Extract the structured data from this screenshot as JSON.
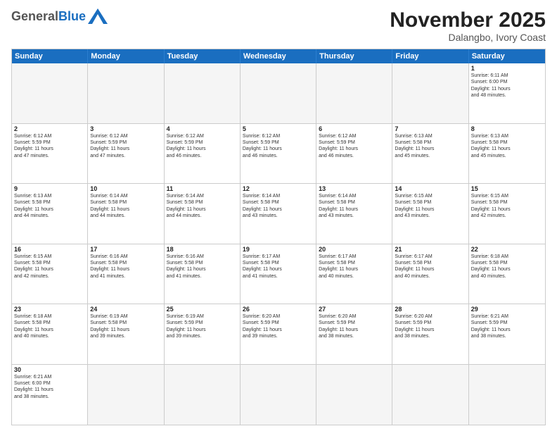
{
  "header": {
    "logo_general": "General",
    "logo_blue": "Blue",
    "month_title": "November 2025",
    "location": "Dalangbo, Ivory Coast"
  },
  "calendar": {
    "days": [
      "Sunday",
      "Monday",
      "Tuesday",
      "Wednesday",
      "Thursday",
      "Friday",
      "Saturday"
    ],
    "cells": [
      {
        "day": "",
        "empty": true,
        "text": ""
      },
      {
        "day": "",
        "empty": true,
        "text": ""
      },
      {
        "day": "",
        "empty": true,
        "text": ""
      },
      {
        "day": "",
        "empty": true,
        "text": ""
      },
      {
        "day": "",
        "empty": true,
        "text": ""
      },
      {
        "day": "",
        "empty": true,
        "text": ""
      },
      {
        "day": "1",
        "empty": false,
        "text": "Sunrise: 6:11 AM\nSunset: 6:00 PM\nDaylight: 11 hours\nand 48 minutes."
      },
      {
        "day": "2",
        "empty": false,
        "text": "Sunrise: 6:12 AM\nSunset: 5:59 PM\nDaylight: 11 hours\nand 47 minutes."
      },
      {
        "day": "3",
        "empty": false,
        "text": "Sunrise: 6:12 AM\nSunset: 5:59 PM\nDaylight: 11 hours\nand 47 minutes."
      },
      {
        "day": "4",
        "empty": false,
        "text": "Sunrise: 6:12 AM\nSunset: 5:59 PM\nDaylight: 11 hours\nand 46 minutes."
      },
      {
        "day": "5",
        "empty": false,
        "text": "Sunrise: 6:12 AM\nSunset: 5:59 PM\nDaylight: 11 hours\nand 46 minutes."
      },
      {
        "day": "6",
        "empty": false,
        "text": "Sunrise: 6:12 AM\nSunset: 5:59 PM\nDaylight: 11 hours\nand 46 minutes."
      },
      {
        "day": "7",
        "empty": false,
        "text": "Sunrise: 6:13 AM\nSunset: 5:58 PM\nDaylight: 11 hours\nand 45 minutes."
      },
      {
        "day": "8",
        "empty": false,
        "text": "Sunrise: 6:13 AM\nSunset: 5:58 PM\nDaylight: 11 hours\nand 45 minutes."
      },
      {
        "day": "9",
        "empty": false,
        "text": "Sunrise: 6:13 AM\nSunset: 5:58 PM\nDaylight: 11 hours\nand 44 minutes."
      },
      {
        "day": "10",
        "empty": false,
        "text": "Sunrise: 6:14 AM\nSunset: 5:58 PM\nDaylight: 11 hours\nand 44 minutes."
      },
      {
        "day": "11",
        "empty": false,
        "text": "Sunrise: 6:14 AM\nSunset: 5:58 PM\nDaylight: 11 hours\nand 44 minutes."
      },
      {
        "day": "12",
        "empty": false,
        "text": "Sunrise: 6:14 AM\nSunset: 5:58 PM\nDaylight: 11 hours\nand 43 minutes."
      },
      {
        "day": "13",
        "empty": false,
        "text": "Sunrise: 6:14 AM\nSunset: 5:58 PM\nDaylight: 11 hours\nand 43 minutes."
      },
      {
        "day": "14",
        "empty": false,
        "text": "Sunrise: 6:15 AM\nSunset: 5:58 PM\nDaylight: 11 hours\nand 43 minutes."
      },
      {
        "day": "15",
        "empty": false,
        "text": "Sunrise: 6:15 AM\nSunset: 5:58 PM\nDaylight: 11 hours\nand 42 minutes."
      },
      {
        "day": "16",
        "empty": false,
        "text": "Sunrise: 6:15 AM\nSunset: 5:58 PM\nDaylight: 11 hours\nand 42 minutes."
      },
      {
        "day": "17",
        "empty": false,
        "text": "Sunrise: 6:16 AM\nSunset: 5:58 PM\nDaylight: 11 hours\nand 41 minutes."
      },
      {
        "day": "18",
        "empty": false,
        "text": "Sunrise: 6:16 AM\nSunset: 5:58 PM\nDaylight: 11 hours\nand 41 minutes."
      },
      {
        "day": "19",
        "empty": false,
        "text": "Sunrise: 6:17 AM\nSunset: 5:58 PM\nDaylight: 11 hours\nand 41 minutes."
      },
      {
        "day": "20",
        "empty": false,
        "text": "Sunrise: 6:17 AM\nSunset: 5:58 PM\nDaylight: 11 hours\nand 40 minutes."
      },
      {
        "day": "21",
        "empty": false,
        "text": "Sunrise: 6:17 AM\nSunset: 5:58 PM\nDaylight: 11 hours\nand 40 minutes."
      },
      {
        "day": "22",
        "empty": false,
        "text": "Sunrise: 6:18 AM\nSunset: 5:58 PM\nDaylight: 11 hours\nand 40 minutes."
      },
      {
        "day": "23",
        "empty": false,
        "text": "Sunrise: 6:18 AM\nSunset: 5:58 PM\nDaylight: 11 hours\nand 40 minutes."
      },
      {
        "day": "24",
        "empty": false,
        "text": "Sunrise: 6:19 AM\nSunset: 5:58 PM\nDaylight: 11 hours\nand 39 minutes."
      },
      {
        "day": "25",
        "empty": false,
        "text": "Sunrise: 6:19 AM\nSunset: 5:59 PM\nDaylight: 11 hours\nand 39 minutes."
      },
      {
        "day": "26",
        "empty": false,
        "text": "Sunrise: 6:20 AM\nSunset: 5:59 PM\nDaylight: 11 hours\nand 39 minutes."
      },
      {
        "day": "27",
        "empty": false,
        "text": "Sunrise: 6:20 AM\nSunset: 5:59 PM\nDaylight: 11 hours\nand 38 minutes."
      },
      {
        "day": "28",
        "empty": false,
        "text": "Sunrise: 6:20 AM\nSunset: 5:59 PM\nDaylight: 11 hours\nand 38 minutes."
      },
      {
        "day": "29",
        "empty": false,
        "text": "Sunrise: 6:21 AM\nSunset: 5:59 PM\nDaylight: 11 hours\nand 38 minutes."
      },
      {
        "day": "30",
        "empty": false,
        "text": "Sunrise: 6:21 AM\nSunset: 6:00 PM\nDaylight: 11 hours\nand 38 minutes."
      },
      {
        "day": "",
        "empty": true,
        "text": ""
      },
      {
        "day": "",
        "empty": true,
        "text": ""
      },
      {
        "day": "",
        "empty": true,
        "text": ""
      },
      {
        "day": "",
        "empty": true,
        "text": ""
      },
      {
        "day": "",
        "empty": true,
        "text": ""
      },
      {
        "day": "",
        "empty": true,
        "text": ""
      }
    ]
  }
}
